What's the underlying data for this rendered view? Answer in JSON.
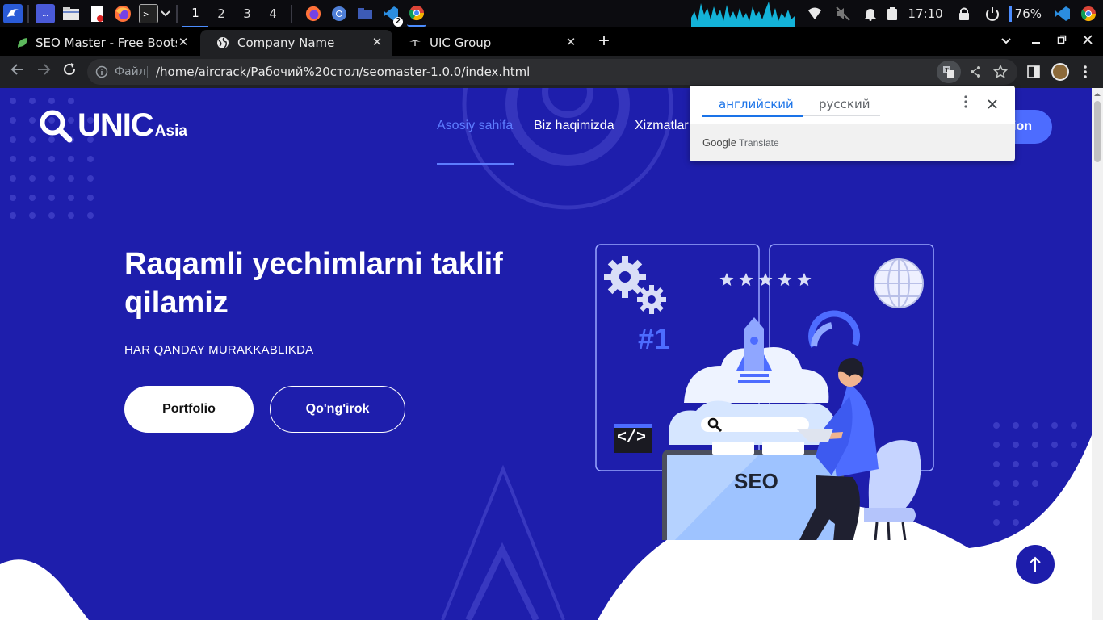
{
  "taskbar": {
    "workspaces": [
      "1",
      "2",
      "3",
      "4"
    ],
    "active_workspace": "1",
    "badge_count": "2",
    "clock": "17:10",
    "battery": "76%",
    "launcher_label": "..."
  },
  "tabs": [
    {
      "title": "SEO Master - Free Bootstrap",
      "active": false
    },
    {
      "title": "Company Name",
      "active": true
    },
    {
      "title": "UIC Group",
      "active": false
    }
  ],
  "addressbar": {
    "prefix": "Файл",
    "url": "/home/aircrack/Рабочий%20стол/seomaster-1.0.0/index.html"
  },
  "site": {
    "logo_main": "UNIC",
    "logo_sub": "Asia",
    "nav": [
      "Asosiy sahifa",
      "Biz haqimizda",
      "Xizmatlar"
    ],
    "cta_partial": "ion",
    "hero_title": "Raqamli yechimlarni taklif qilamiz",
    "hero_subtitle": "HAR QANDAY MURAKKABLIKDA",
    "btn_portfolio": "Portfolio",
    "btn_call": "Qo'ng'irok",
    "illustration_text": {
      "rank": "#1",
      "seo": "SEO",
      "code": "</>"
    }
  },
  "translate_popup": {
    "tab_source": "английский",
    "tab_target": "русский",
    "brand_google": "Google",
    "brand_translate": "Translate"
  },
  "colors": {
    "page_bg": "#1e1eac",
    "accent": "#4d6cff",
    "nav_active": "#5d7cff"
  }
}
